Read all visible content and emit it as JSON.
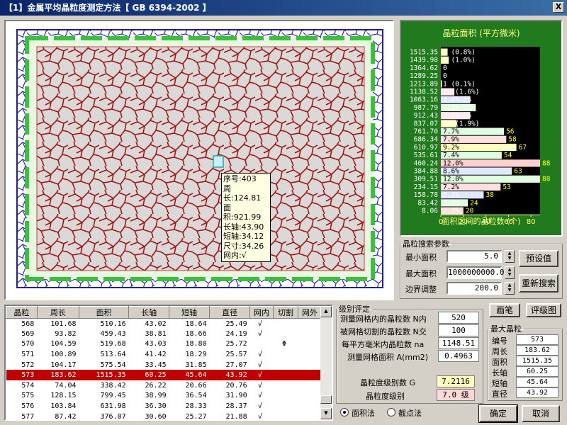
{
  "window": {
    "title": "【1】金属平均晶粒度测定方法【 GB 6394-2002 】",
    "close_label": "X"
  },
  "tooltip": {
    "lines": [
      "序号:403",
      "周长:124.81",
      "面积:921.99",
      "长轴:43.90",
      "短轴:34.12",
      "尺寸:34.26",
      "网内:√"
    ]
  },
  "chart_data": {
    "type": "bar",
    "title": "晶粒面积 (平方微米)",
    "xlabel": "面积区间的晶粒数 (个)",
    "ylabel": "",
    "xlim": [
      0,
      88
    ],
    "x_ticks": [
      "0",
      "20",
      "40",
      "60",
      "80"
    ],
    "categories": [
      "1515.35",
      "1439.98",
      "1364.62",
      "1289.25",
      "1213.89",
      "1138.52",
      "1063.16",
      "987.79",
      "912.43",
      "837.07",
      "761.70",
      "686.34",
      "610.97",
      "535.61",
      "460.24",
      "384.88",
      "309.51",
      "234.15",
      "158.78",
      "83.42",
      "8.06"
    ],
    "values": [
      6,
      7,
      0,
      0,
      1,
      12,
      26,
      31,
      26,
      14,
      56,
      58,
      67,
      54,
      88,
      63,
      88,
      53,
      38,
      24,
      20
    ],
    "labels": [
      "6  (0.8%)",
      "7  (1.0%)",
      "0",
      "0",
      "1  (0.1%)",
      "12 (1.6%)",
      "3.6%  26",
      "4.2%  31",
      "3.6%  26",
      "14 (1.9%)",
      "7.7%",
      "7.9%",
      "9.2%",
      "7.4%",
      "12.0%",
      "8.6%",
      "12.0%",
      "7.2%",
      "5.2%",
      "3.3%",
      "2.7%"
    ],
    "side_values": [
      "",
      "",
      "",
      "",
      "",
      "",
      "",
      "",
      "",
      "",
      "56",
      "58",
      "67",
      "54",
      "88",
      "63",
      "88",
      "53",
      "38",
      "24",
      "20"
    ],
    "colors": [
      "#ffffc0",
      "#ffffc0",
      "#ffffc0",
      "#ffffc0",
      "#ffffc0",
      "#ffe8f0",
      "#e0e8ff",
      "#e0ffe0",
      "#ffe8f0",
      "#ffffc0",
      "#e0ffe0",
      "#ffe0e0",
      "#ffffc0",
      "#e0ffe0",
      "#ffd0d0",
      "#e0e8ff",
      "#e0ffe0",
      "#ffe0e0",
      "#e0e8ff",
      "#e0ffe0",
      "#ffe0e0"
    ]
  },
  "search": {
    "legend": "晶粒搜索参数",
    "min_area_label": "最小面积",
    "min_area": "5.0",
    "max_area_label": "最大面积",
    "max_area": "1000000000.0",
    "border_label": "边界调整",
    "border": "200.0",
    "preset_btn": "预设值",
    "research_btn": "重新搜索"
  },
  "table": {
    "headers": [
      "晶粒",
      "周长",
      "面积",
      "长轴",
      "短轴",
      "直径",
      "网内",
      "切割",
      "网外"
    ],
    "rows": [
      [
        "568",
        "101.68",
        "510.16",
        "43.02",
        "18.64",
        "25.49",
        "√",
        "",
        ""
      ],
      [
        "569",
        "93.82",
        "459.43",
        "38.81",
        "18.66",
        "24.19",
        "√",
        "",
        ""
      ],
      [
        "570",
        "104.59",
        "519.68",
        "43.03",
        "18.80",
        "25.72",
        "",
        "Φ",
        ""
      ],
      [
        "571",
        "100.89",
        "513.64",
        "41.42",
        "18.29",
        "25.57",
        "√",
        "",
        ""
      ],
      [
        "572",
        "104.17",
        "575.54",
        "33.45",
        "31.85",
        "27.07",
        "√",
        "",
        ""
      ],
      [
        "573",
        "183.62",
        "1515.35",
        "60.25",
        "45.64",
        "43.92",
        "√",
        "",
        ""
      ],
      [
        "574",
        "74.04",
        "338.42",
        "26.22",
        "20.66",
        "20.76",
        "√",
        "",
        ""
      ],
      [
        "575",
        "128.15",
        "799.45",
        "38.99",
        "36.54",
        "31.90",
        "√",
        "",
        ""
      ],
      [
        "576",
        "103.84",
        "631.98",
        "36.30",
        "28.33",
        "28.37",
        "√",
        "",
        ""
      ],
      [
        "577",
        "87.42",
        "376.07",
        "30.60",
        "25.27",
        "21.88",
        "√",
        "",
        ""
      ]
    ],
    "selected_index": 5
  },
  "grade": {
    "legend": "级别评定",
    "items": [
      {
        "label": "测量网格内的晶粒数 N内",
        "value": "520"
      },
      {
        "label": "被网格切割的晶粒数 N交",
        "value": "100"
      },
      {
        "label": "每平方毫米内晶粒数 na",
        "value": "1148.51"
      },
      {
        "label": "测量网格面积 A(mm2)",
        "value": "0.4963"
      }
    ],
    "g_label": "晶粒度级别数 G",
    "g_value": "7.2116",
    "level_label": "晶粒度级别",
    "level_value": "7.0 级"
  },
  "buttons": {
    "pen": "画笔",
    "report": "评级图",
    "ok": "确定",
    "cancel": "取消"
  },
  "maxgrain": {
    "legend": "最大晶粒",
    "items": [
      {
        "label": "编号",
        "value": "573"
      },
      {
        "label": "周长",
        "value": "183.62"
      },
      {
        "label": "面积",
        "value": "1515.35"
      },
      {
        "label": "长轴",
        "value": "60.25"
      },
      {
        "label": "短轴",
        "value": "45.64"
      },
      {
        "label": "直径",
        "value": "43.92"
      }
    ]
  },
  "method": {
    "area_label": "面积法",
    "intercept_label": "截点法",
    "selected": "area"
  }
}
